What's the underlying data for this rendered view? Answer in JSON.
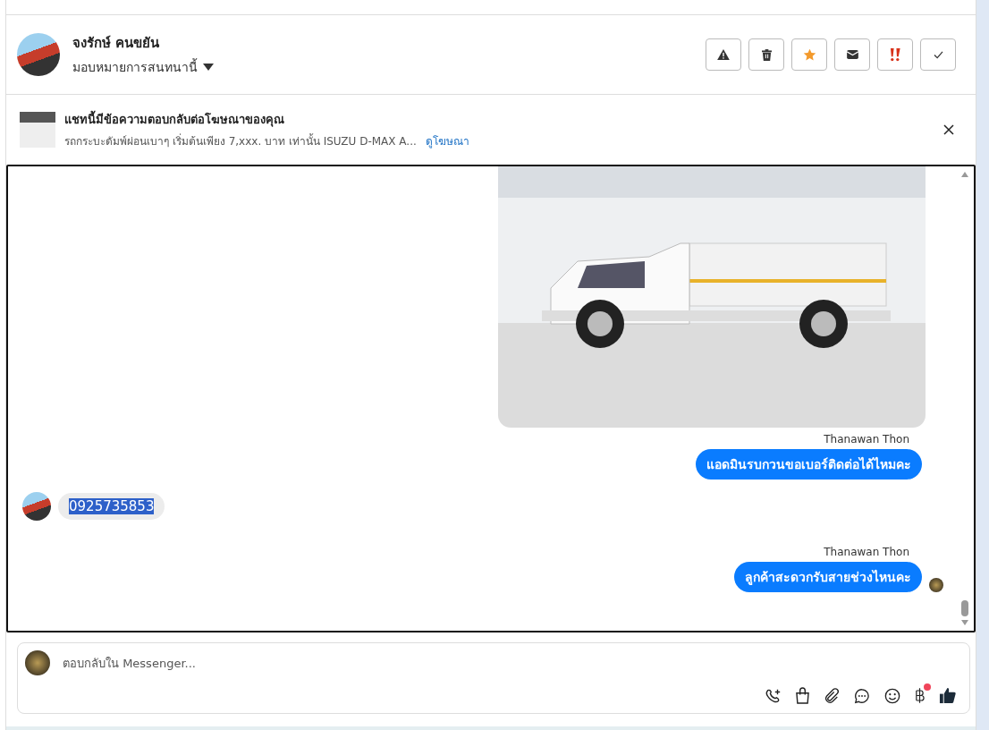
{
  "header": {
    "contact_name": "จงรักษ์ คนขยัน",
    "assign_label": "มอบหมายการสนทนานี้"
  },
  "actions": [
    {
      "kind": "warning"
    },
    {
      "kind": "trash"
    },
    {
      "kind": "star"
    },
    {
      "kind": "mail"
    },
    {
      "kind": "urgent"
    },
    {
      "kind": "check"
    }
  ],
  "ad_banner": {
    "title": "แชทนี้มีข้อความตอบกลับต่อโฆษณาของคุณ",
    "description": "รถกระบะดัมพ์ผ่อนเบาๆ เริ่มต้นเพียง 7,xxx. บาท เท่านั้น ISUZU D-MAX A...",
    "link": "ดูโฆษณา"
  },
  "messages": [
    {
      "kind": "photo_out"
    },
    {
      "kind": "text_out",
      "sender": "Thanawan Thon",
      "text": "แอดมินรบกวนขอเบอร์ติดต่อได้ไหมคะ",
      "seen": false,
      "text_selected": false
    },
    {
      "kind": "text_in",
      "text": "0925735853",
      "text_selected": true
    },
    {
      "kind": "text_out",
      "sender": "Thanawan Thon",
      "text": "ลูกค้าสะดวกรับสายช่วงไหนคะ",
      "seen": true,
      "text_selected": false
    }
  ],
  "composer": {
    "placeholder": "ตอบกลับใน Messenger...",
    "tools": [
      {
        "kind": "call"
      },
      {
        "kind": "bag"
      },
      {
        "kind": "attach"
      },
      {
        "kind": "chat"
      },
      {
        "kind": "emoji"
      },
      {
        "kind": "baht",
        "badge": true
      },
      {
        "kind": "like"
      }
    ]
  }
}
